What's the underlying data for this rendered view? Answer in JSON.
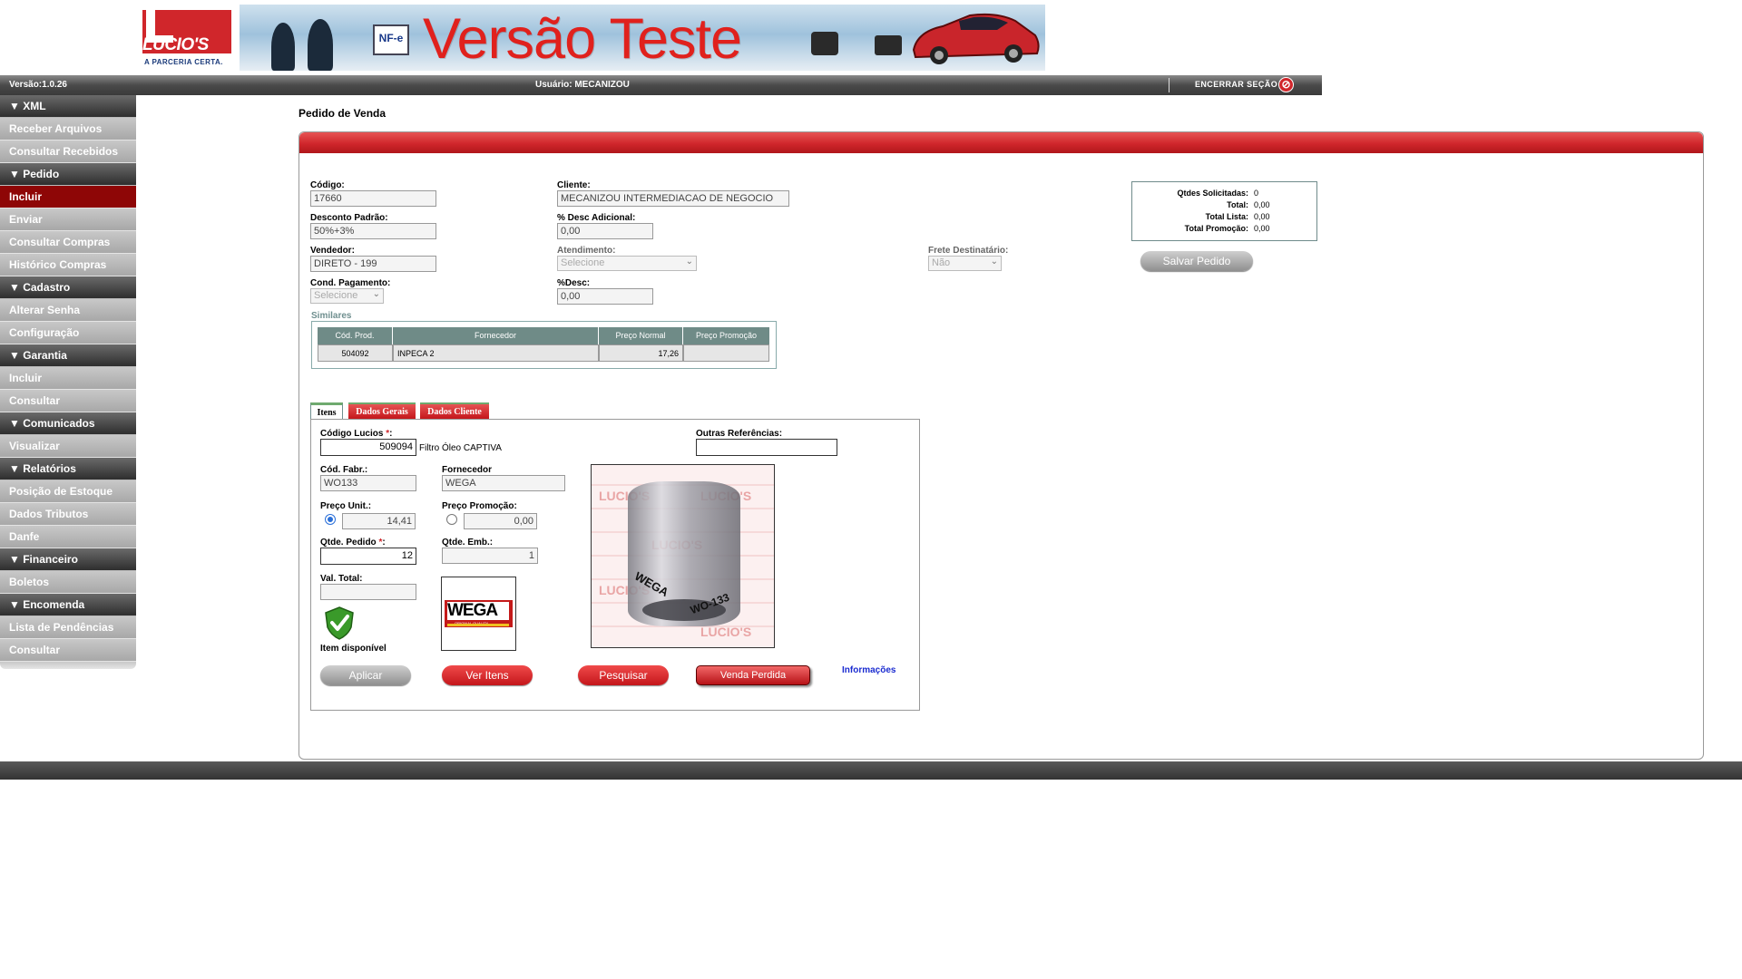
{
  "banner": {
    "logo_text": "LUCIO'S",
    "logo_tagline": "A PARCERIA CERTA.",
    "title": "Versão Teste",
    "nfe_label": "NF-e"
  },
  "topbar": {
    "version": "Versão:1.0.26",
    "user": "Usuário: MECANIZOU",
    "logout_label": "ENCERRAR SEÇÃO"
  },
  "sidebar": {
    "sections": [
      {
        "title": "XML",
        "items": [
          "Receber Arquivos",
          "Consultar Recebidos"
        ]
      },
      {
        "title": "Pedido",
        "items": [
          "Incluir",
          "Enviar",
          "Consultar Compras",
          "Histórico Compras"
        ]
      },
      {
        "title": "Cadastro",
        "items": [
          "Alterar Senha",
          "Configuração"
        ]
      },
      {
        "title": "Garantia",
        "items": [
          "Incluir",
          "Consultar"
        ]
      },
      {
        "title": "Comunicados",
        "items": [
          "Visualizar"
        ]
      },
      {
        "title": "Relatórios",
        "items": [
          "Posição de Estoque",
          "Dados Tributos",
          "Danfe"
        ]
      },
      {
        "title": "Financeiro",
        "items": [
          "Boletos"
        ]
      },
      {
        "title": "Encomenda",
        "items": [
          "Lista de Pendências",
          "Consultar"
        ]
      }
    ],
    "active_item": "Incluir"
  },
  "page": {
    "title": "Pedido de Venda"
  },
  "form": {
    "codigo_label": "Código:",
    "codigo_value": "17660",
    "cliente_label": "Cliente:",
    "cliente_value": "MECANIZOU INTERMEDIACAO DE NEGOCIO",
    "desconto_padrao_label": "Desconto Padrão:",
    "desconto_padrao_value": "50%+3%",
    "desc_adicional_label": "% Desc Adicional:",
    "desc_adicional_value": "0,00",
    "vendedor_label": "Vendedor:",
    "vendedor_value": "DIRETO - 199",
    "atendimento_label": "Atendimento:",
    "atendimento_value": "Selecione",
    "frete_label": "Frete Destinatário:",
    "frete_value": "Não",
    "cond_pagamento_label": "Cond. Pagamento:",
    "cond_pagamento_value": "Selecione",
    "desc_label": "%Desc:",
    "desc_value": "0,00"
  },
  "totals": {
    "qtdes_label": "Qtdes Solicitadas:",
    "qtdes_value": "0",
    "total_label": "Total:",
    "total_value": "0,00",
    "total_lista_label": "Total Lista:",
    "total_lista_value": "0,00",
    "total_promocao_label": "Total Promoção:",
    "total_promocao_value": "0,00"
  },
  "salvar_label": "Salvar Pedido",
  "similares": {
    "label": "Similares",
    "headers": [
      "Cód. Prod.",
      "Fornecedor",
      "Preço Normal",
      "Preço Promoção"
    ],
    "rows": [
      {
        "cod": "504092",
        "fornecedor": "INPECA 2",
        "preco_normal": "17,26",
        "preco_promocao": ""
      }
    ]
  },
  "tabs": [
    "Itens",
    "Dados Gerais",
    "Dados Cliente"
  ],
  "item": {
    "codigo_lucios_label": "Código Lucios",
    "codigo_lucios_value": "509094",
    "descricao": "Filtro Óleo CAPTIVA",
    "outras_ref_label": "Outras Referências:",
    "outras_ref_value": "",
    "cod_fabr_label": "Cód. Fabr.:",
    "cod_fabr_value": "WO133",
    "fornecedor_label": "Fornecedor",
    "fornecedor_value": "WEGA",
    "preco_unit_label": "Preço Unit.:",
    "preco_unit_value": "14,41",
    "preco_promocao_label": "Preço Promoção:",
    "preco_promocao_value": "0,00",
    "qtde_pedido_label": "Qtde. Pedido",
    "qtde_pedido_value": "12",
    "qtde_emb_label": "Qtde. Emb.:",
    "qtde_emb_value": "1",
    "val_total_label": "Val. Total:",
    "val_total_value": "",
    "disponivel_label": "Item disponível",
    "brand_text": "WEGA",
    "brand_sub": "ORIGINAL QUALITY",
    "product_code": "WO-133",
    "watermark": "LUCIO'S"
  },
  "buttons": {
    "aplicar": "Aplicar",
    "ver_itens": "Ver Itens",
    "pesquisar": "Pesquisar",
    "venda_perdida": "Venda Perdida",
    "informacoes": "Informações"
  },
  "colors": {
    "brand_red": "#d0262b",
    "active_item": "#8e0606",
    "teal": "#6f8b87"
  }
}
